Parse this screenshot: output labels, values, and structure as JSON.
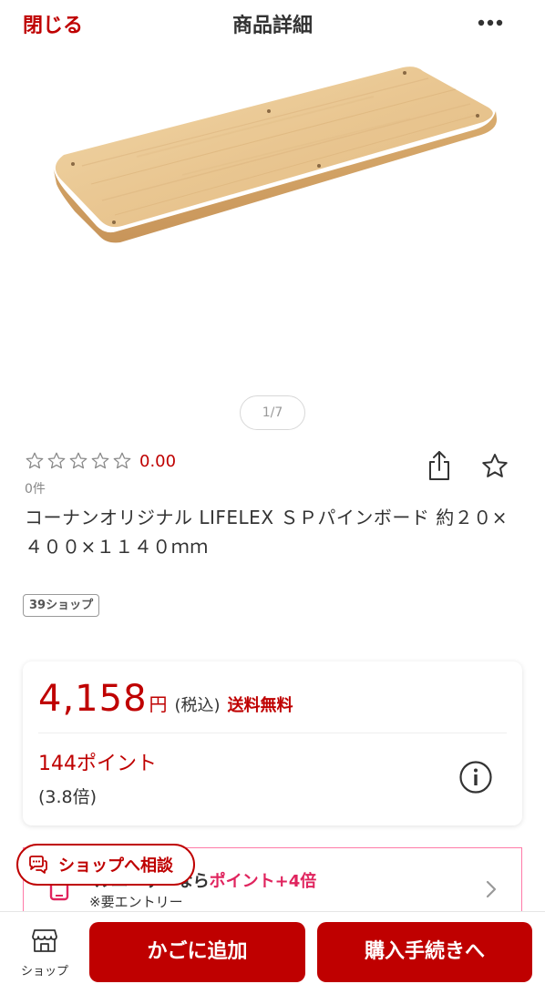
{
  "header": {
    "close_label": "閉じる",
    "title": "商品詳細",
    "more_icon": "ellipsis-icon"
  },
  "gallery": {
    "pager": "1/7"
  },
  "rating": {
    "stars": 0,
    "max_stars": 5,
    "value": "0.00",
    "review_count": "0件"
  },
  "product": {
    "name": "コーナンオリジナル LIFELEX ＳＰパインボード 約２０×４００×１１４０ｍｍ",
    "shop_tag": "39ショップ"
  },
  "price": {
    "amount": "4,158",
    "yen": "円",
    "tax_label": "(税込)",
    "shipping": "送料無料",
    "points": "144ポイント",
    "points_rate": "(3.8倍)"
  },
  "campaign": {
    "text_prefix": "ルユーザーなら",
    "text_highlight": "ポイント+4倍",
    "sub": "※要エントリー"
  },
  "consult": {
    "label": "ショップへ相談"
  },
  "bottom_bar": {
    "shop_label": "ショップ",
    "add_to_cart": "かごに追加",
    "checkout": "購入手続きへ"
  },
  "colors": {
    "accent": "#bf0000",
    "campaign_pink": "#e0245e",
    "wood": "#e8c99a"
  }
}
